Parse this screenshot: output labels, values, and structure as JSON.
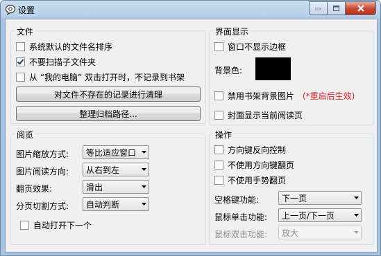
{
  "window": {
    "title": "设置"
  },
  "file": {
    "title": "文件",
    "checkboxes": [
      {
        "label": "系统默认的文件名排序",
        "checked": false
      },
      {
        "label": "不要扫描子文件夹",
        "checked": true
      },
      {
        "label": "从 “我的电脑” 双击打开时，不记录到书架",
        "checked": false
      }
    ],
    "clean_button": "对文件不存在的记录进行清理",
    "archive_button": "整理归档路径..."
  },
  "display": {
    "title": "界面显示",
    "no_border": {
      "label": "窗口不显示边框",
      "checked": false
    },
    "bg_color_label": "背景色:",
    "bg_color": "#000000",
    "disable_bg": {
      "label": "禁用书架背景图片",
      "checked": false
    },
    "restart_note": "(*重启后生效)",
    "cover_current": {
      "label": "封面显示当前阅读页",
      "checked": false
    }
  },
  "reading": {
    "title": "阅览",
    "rows": [
      {
        "label": "图片缩放方式:",
        "value": "等比适应窗口"
      },
      {
        "label": "图片阅读方向:",
        "value": "从右到左"
      },
      {
        "label": "翻页效果:",
        "value": "滑出"
      },
      {
        "label": "分页切割方式:",
        "value": "自动判断"
      }
    ],
    "auto_next": {
      "label": "自动打开下一个",
      "checked": false
    }
  },
  "operation": {
    "title": "操作",
    "checkboxes": [
      {
        "label": "方向键反向控制",
        "checked": false
      },
      {
        "label": "不使用方向键翻页",
        "checked": false
      },
      {
        "label": "不使用手势翻页",
        "checked": false
      }
    ],
    "rows": [
      {
        "label": "空格键功能:",
        "value": "下一页",
        "disabled": false
      },
      {
        "label": "鼠标单击功能:",
        "value": "上一页/下一页",
        "disabled": false
      },
      {
        "label": "鼠标双击功能:",
        "value": "放大",
        "disabled": true
      }
    ]
  }
}
